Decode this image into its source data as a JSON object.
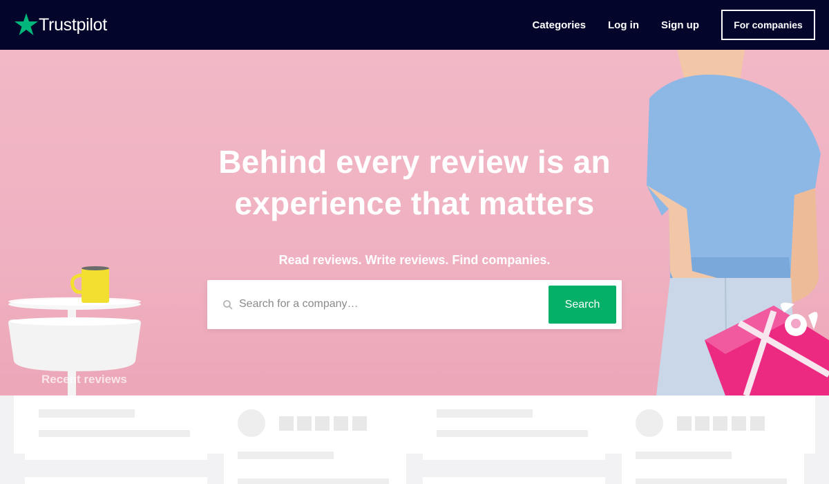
{
  "header": {
    "logo_text": "Trustpilot",
    "nav": [
      {
        "label": "Categories"
      },
      {
        "label": "Log in"
      },
      {
        "label": "Sign up"
      }
    ],
    "cta_label": "For companies"
  },
  "hero": {
    "title_line1": "Behind every review is an",
    "title_line2": "experience that matters",
    "subtitle": "Read reviews. Write reviews. Find companies.",
    "search_placeholder": "Search for a company…",
    "search_button": "Search"
  },
  "recent": {
    "label": "Recent reviews"
  },
  "colors": {
    "header_bg": "#04052b",
    "brand_green": "#00b67a",
    "search_button": "#04b068",
    "hero_pink": "#efb1c1"
  },
  "icons": [
    "trustpilot-star-logo",
    "search-icon",
    "rating-star"
  ]
}
